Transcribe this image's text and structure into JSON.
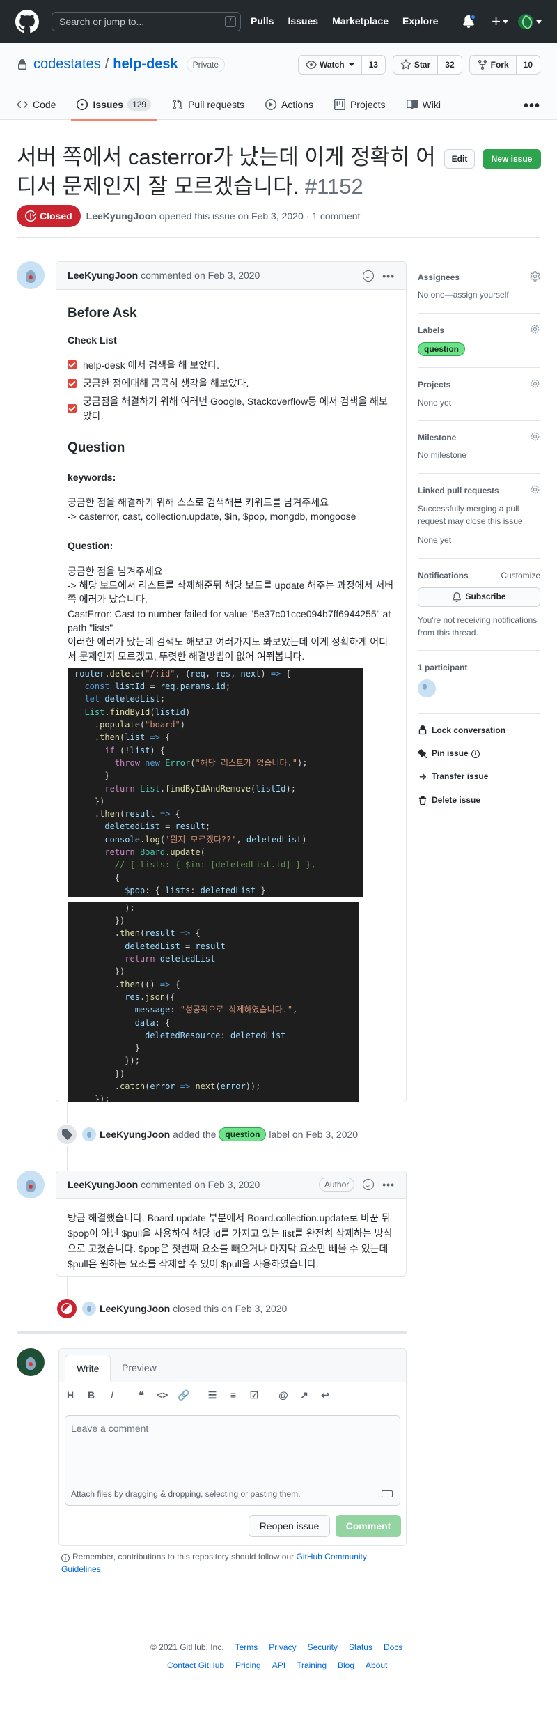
{
  "topbar": {
    "search_placeholder": "Search or jump to...",
    "slash": "/",
    "nav": [
      "Pulls",
      "Issues",
      "Marketplace",
      "Explore"
    ]
  },
  "repo": {
    "owner": "codestates",
    "sep": "/",
    "name": "help-desk",
    "visibility": "Private",
    "watch_label": "Watch",
    "watch_count": "13",
    "star_label": "Star",
    "star_count": "32",
    "fork_label": "Fork",
    "fork_count": "10",
    "tabs": [
      {
        "label": "Code"
      },
      {
        "label": "Issues",
        "count": "129"
      },
      {
        "label": "Pull requests"
      },
      {
        "label": "Actions"
      },
      {
        "label": "Projects"
      },
      {
        "label": "Wiki"
      }
    ]
  },
  "issue": {
    "title": "서버 쪽에서 casterror가 났는데 이게 정확히 어디서 문제인지 잘 모르겠습니다.",
    "number": "#1152",
    "edit_label": "Edit",
    "new_issue_label": "New issue",
    "state": "Closed",
    "author": "LeeKyungJoon",
    "opened_text": "opened this issue on Feb 3, 2020 · 1 comment"
  },
  "comment1": {
    "author": "LeeKyungJoon",
    "meta": "commented on Feb 3, 2020",
    "h_before": "Before Ask",
    "h_checklist": "Check List",
    "checks": [
      "help-desk 에서 검색을 해 보았다.",
      "궁금한 점에대해 곰곰히 생각을 해보았다.",
      "궁금점을 해결하기 위해 여러번 Google, Stackoverflow등 에서 검색을 해보았다."
    ],
    "h_question": "Question",
    "h_keywords": "keywords:",
    "keywords_1": "궁금한 점을 해결하기 위해 스스로 검색해본 키워드를 남겨주세요",
    "keywords_2": "-> casterror, cast, collection.update, $in, $pop, mongdb, mongoose",
    "h_question2": "Question:",
    "q_1": "궁금한 점을 남겨주세요",
    "q_2": "-> 해당 보드에서 리스트를 삭제해준뒤 해당 보드를 update 해주는 과정에서 서버 쪽 에러가 났습니다.",
    "q_3": "CastError: Cast to number failed for value \"5e37c01cce094b7ff6944255\" at path \"lists\"",
    "q_4": "이러한 에러가 났는데 검색도 해보고 여러가지도 봐보았는데 이게 정확하게 어디서 문제인지 모르겠고, 뚜렷한 해결방법이 없어 여쭤봅니다."
  },
  "event_label": {
    "author": "LeeKyungJoon",
    "text_before": "added the",
    "label": "question",
    "text_after": "label on Feb 3, 2020"
  },
  "comment2": {
    "author": "LeeKyungJoon",
    "meta": "commented on Feb 3, 2020",
    "author_tag": "Author",
    "body": "방금 해결했습니다. Board.update 부분에서 Board.collection.update로 바꾼 뒤 $pop이 아닌 $pull을 사용하여 해당 id를 가지고 있는 list를 완전히 삭제하는 방식으로 고쳤습니다. $pop은 첫번째 요소를 빼오거나 마지막 요소만 빼올 수 있는데 $pull은 원하는 요소를 삭제할 수 있어 $pull을 사용하였습니다."
  },
  "event_closed": {
    "author": "LeeKyungJoon",
    "text": "closed this on Feb 3, 2020"
  },
  "sidebar": {
    "assignees_title": "Assignees",
    "assignees_val": "No one—assign yourself",
    "labels_title": "Labels",
    "label": "question",
    "projects_title": "Projects",
    "projects_val": "None yet",
    "milestone_title": "Milestone",
    "milestone_val": "No milestone",
    "linked_title": "Linked pull requests",
    "linked_desc": "Successfully merging a pull request may close this issue.",
    "linked_val": "None yet",
    "notif_title": "Notifications",
    "customize": "Customize",
    "subscribe": "Subscribe",
    "notif_desc": "You're not receiving notifications from this thread.",
    "participants": "1 participant",
    "lock": "Lock conversation",
    "pin": "Pin issue",
    "transfer": "Transfer issue",
    "delete": "Delete issue"
  },
  "editor": {
    "tab_write": "Write",
    "tab_preview": "Preview",
    "placeholder": "Leave a comment",
    "attach": "Attach files by dragging & dropping, selecting or pasting them.",
    "reopen": "Reopen issue",
    "comment": "Comment",
    "reminder": "Remember, contributions to this repository should follow our",
    "reminder_link": "GitHub Community Guidelines."
  },
  "footer": {
    "copyright": "© 2021 GitHub, Inc.",
    "row1": [
      "Terms",
      "Privacy",
      "Security",
      "Status",
      "Docs"
    ],
    "row2": [
      "Contact GitHub",
      "Pricing",
      "API",
      "Training",
      "Blog",
      "About"
    ]
  }
}
